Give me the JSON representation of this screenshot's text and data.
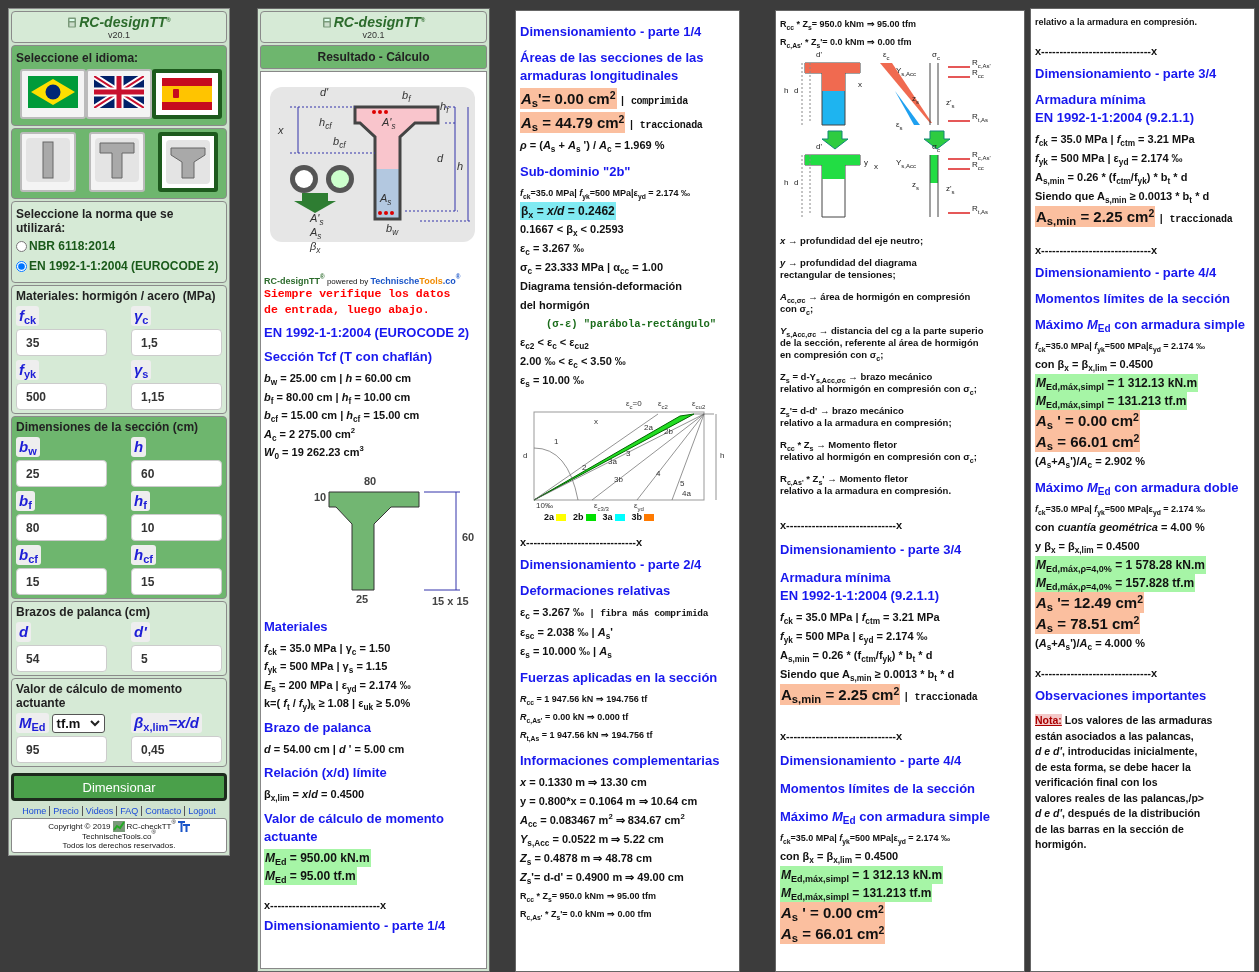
{
  "input_panel": {
    "header": {
      "title": "RC-designTT$^{®}$",
      "version": "v20.1"
    },
    "language": {
      "label": "Seleccione el idioma:",
      "flags": [
        {
          "kind": "brazil",
          "selected": false
        },
        {
          "kind": "uk",
          "selected": false
        },
        {
          "kind": "spain",
          "selected": true
        }
      ]
    },
    "section_types": [
      {
        "kind": "rect",
        "selected": false
      },
      {
        "kind": "tee",
        "selected": false
      },
      {
        "kind": "tee-chamfer",
        "selected": true
      }
    ],
    "norm": {
      "label": "Seleccione la norma que se utilizará:",
      "options": [
        {
          "label": "NBR 6118:2014",
          "selected": false
        },
        {
          "label": "EN 1992-1-1:2004 (EUROCODE 2)",
          "selected": true
        }
      ]
    },
    "groups": [
      {
        "title": "Materiales: hormigón / acero (MPa)",
        "highlighted": false,
        "fields": [
          {
            "label": "f$_{ck}$",
            "value": "35"
          },
          {
            "label": "γ$_{c}$",
            "value": "1,5"
          },
          {
            "label": "f$_{yk}$",
            "value": "500"
          },
          {
            "label": "γ$_{s}$",
            "value": "1,15"
          }
        ]
      },
      {
        "title": "Dimensiones de la sección (cm)",
        "highlighted": true,
        "fields": [
          {
            "label": "b$_{w}$",
            "value": "25"
          },
          {
            "label": "h",
            "value": "60"
          },
          {
            "label": "b$_{f}$",
            "value": "80"
          },
          {
            "label": "h$_{f}$",
            "value": "10"
          },
          {
            "label": "b$_{cf}$",
            "value": "15"
          },
          {
            "label": "h$_{cf}$",
            "value": "15"
          }
        ]
      },
      {
        "title": "Brazos de palanca (cm)",
        "highlighted": false,
        "fields": [
          {
            "label": "d",
            "value": "54"
          },
          {
            "label": "d'",
            "value": "5"
          }
        ]
      },
      {
        "title": "Valor de cálculo de momento actuante",
        "highlighted": false,
        "fields": [
          {
            "label": "M$_{Ed}$",
            "unit": "tf.m",
            "value": "95"
          },
          {
            "label": "β$_{x,lim}$=x/d",
            "value": "0,45"
          }
        ]
      }
    ],
    "submit": "Dimensionar",
    "footer_links": [
      "Home",
      "Precio",
      "Videos",
      "FAQ",
      "Contacto",
      "Logout"
    ],
    "copyright": {
      "text": "Copyright © 2019",
      "product": "RC-checkTT$^{®}$",
      "site": "TechnischeTools.co$^{®}$",
      "rights": "Todos los derechos reservados."
    }
  },
  "results": {
    "header": {
      "title": "RC-designTT$^{®}$",
      "version": "v20.1",
      "caption": "Resultado - Cálculo"
    },
    "columns": [
      {
        "blocks": [
          {
            "kind": "section-illustration",
            "labels": [
              "d'",
              "b$_{f}$",
              "A'$_{s}$",
              "h$_{f}$",
              "x",
              "h$_{cf}$",
              "b$_{cf}$",
              "d",
              "h",
              "A'$_{s}$",
              "A$_{s}$",
              "β$_{x}$",
              "A$_{s}$",
              "b$_{w}$"
            ]
          },
          {
            "kind": "brand",
            "parts": [
              "RC-designTT$^{®}$",
              "powered by",
              "Technische",
              "Tools",
              ".co$^{®}$"
            ]
          },
          {
            "kind": "warning",
            "text": "Siempre verifique los datos\nde entrada, luego abajo."
          },
          {
            "kind": "heading",
            "text": "EN 1992-1-1:2004 (EUROCODE 2)"
          },
          {
            "kind": "heading",
            "text": "Sección Tcf (T con chaflán)"
          },
          {
            "kind": "line",
            "text": "*b*$_{w}$ = 25.00 cm | *h* = 60.00 cm"
          },
          {
            "kind": "line",
            "text": "*b*$_{f}$ = 80.00 cm | *h*$_{f}$ = 10.00 cm"
          },
          {
            "kind": "line",
            "text": "*b*$_{cf}$ = 15.00 cm | *h*$_{cf}$ = 15.00 cm"
          },
          {
            "kind": "line",
            "text": "*A*$_{c}$ = 2 275.00 cm$^{2}$"
          },
          {
            "kind": "line",
            "text": "*W*$_{0}$ = 19 262.23 cm$^{3}$"
          },
          {
            "kind": "tee-drawing",
            "labels": [
              "80",
              "10",
              "60",
              "25",
              "15 x 15"
            ]
          },
          {
            "kind": "heading",
            "text": "Materiales"
          },
          {
            "kind": "line",
            "text": "*f*$_{ck}$ = 35.0 MPa | γ$_{c}$ = 1.50"
          },
          {
            "kind": "line",
            "text": "*f*$_{yk}$ = 500 MPa | γ$_{s}$ = 1.15"
          },
          {
            "kind": "line",
            "text": "*E*$_{s}$ = 200 MPa | ε$_{yd}$ = 2.174 ‰"
          },
          {
            "kind": "line",
            "text": "k=( *f*$_{t}$ / *f*$_{y}$)$_{k}$ ≥ 1.08 | ε$_{uk}$ ≥ 5.0%"
          },
          {
            "kind": "heading",
            "text": "Brazo de palanca"
          },
          {
            "kind": "line",
            "text": "*d* = 54.00 cm | *d* ' = 5.00 cm"
          },
          {
            "kind": "heading",
            "text": "Relación (x/d) límite"
          },
          {
            "kind": "line",
            "text": "β$_{x,lim}$ = *x*/*d* = 0.4500"
          },
          {
            "kind": "heading",
            "text": "Valor de cálculo de momento actuante"
          },
          {
            "kind": "result",
            "text": "*M*$_{Ed}$ = 950.00 kN.m",
            "color": "#a6f5a6"
          },
          {
            "kind": "result",
            "text": "*M*$_{Ed}$ = 95.00 tf.m",
            "color": "#a6f5a6"
          },
          {
            "kind": "separator",
            "text": "x------------------------------x"
          },
          {
            "kind": "heading",
            "text": "Dimensionamiento - parte 1/4"
          }
        ]
      },
      {
        "blocks": [
          {
            "kind": "heading",
            "text": "Dimensionamiento - parte 1/4"
          },
          {
            "kind": "heading",
            "text": "Áreas de las secciones de las armaduras longitudinales"
          },
          {
            "kind": "big-result",
            "text": "*A*$_{s}$'= 0.00 cm$^{2}$",
            "note": "| comprimida",
            "color": "#fbbf9f"
          },
          {
            "kind": "big-result",
            "text": "*A*$_{s}$ = 44.79 cm$^{2}$",
            "note": "| traccionada",
            "color": "#fbbf9f"
          },
          {
            "kind": "line",
            "text": "*ρ* = (*A*$_{s}$ + *A*$_{s}$ ') / *A*$_{c}$ = 1.969 %"
          },
          {
            "kind": "heading",
            "text": "Sub-dominio \"2b\""
          },
          {
            "kind": "small",
            "text": "*f*$_{ck}$=35.0 MPa| *f*$_{yk}$=500 MPa|ε$_{yd}$ = 2.174 ‰"
          },
          {
            "kind": "result",
            "text": "β$_{x}$ = *x/d* = 0.2462",
            "color": "#80eaf2"
          },
          {
            "kind": "line",
            "text": "0.1667 < β$_{x}$ < 0.2593"
          },
          {
            "kind": "line",
            "text": "ε$_{c}$ = 3.267 ‰"
          },
          {
            "kind": "line",
            "text": "σ$_{c}$ = 23.333 MPa | α$_{cc}$ = 1.00"
          },
          {
            "kind": "line",
            "text": "Diagrama tensión-deformación\ndel hormigón"
          },
          {
            "kind": "formula",
            "text": "(σ-ε) \"parábola-rectángulo\""
          },
          {
            "kind": "line",
            "text": "ε$_{c2}$ < ε$_{c}$ < ε$_{cu2}$"
          },
          {
            "kind": "line",
            "text": "2.00 ‰ < ε$_{c}$ < 3.50 ‰"
          },
          {
            "kind": "line",
            "text": "ε$_{s}$ = 10.00 ‰"
          },
          {
            "kind": "strain-drawing",
            "labels": [
              "ε$_{c}$=0",
              "ε$_{c2}$",
              "ε$_{cu2}$",
              "x",
              "d",
              "h",
              "1",
              "2",
              "3",
              "4",
              "5",
              "2a",
              "2b",
              "3a",
              "3b",
              "4a",
              "10‰",
              "ε$_{c3/3}$",
              "ε$_{yd}$"
            ],
            "legend": [
              {
                "label": "2a",
                "color": "#ffff00"
              },
              {
                "label": "2b",
                "color": "#00e000"
              },
              {
                "label": "3a",
                "color": "#00ffff"
              },
              {
                "label": "3b",
                "color": "#ff7a00"
              }
            ]
          },
          {
            "kind": "separator",
            "text": "x------------------------------x"
          },
          {
            "kind": "heading",
            "text": "Dimensionamiento - parte 2/4"
          },
          {
            "kind": "heading",
            "text": "Deformaciones relativas"
          },
          {
            "kind": "line",
            "text": "ε$_{c}$ = 3.267 ‰",
            "note": "| fibra más comprimida"
          },
          {
            "kind": "line",
            "text": "ε$_{sc}$ = 2.038 ‰ | *A*$_{s}$'"
          },
          {
            "kind": "line",
            "text": "ε$_{s}$ = 10.000 ‰ | *A*$_{s}$"
          },
          {
            "kind": "heading",
            "text": "Fuerzas aplicadas en la sección"
          },
          {
            "kind": "small",
            "text": "*R*$_{cc}$ = 1 947.56 kN ⇒ 194.756 tf"
          },
          {
            "kind": "small",
            "text": "*R*$_{c,As'}$ = 0.00 kN ⇒ 0.000 tf"
          },
          {
            "kind": "small",
            "text": "*R*$_{t,As}$ = 1 947.56 kN ⇒ 194.756 tf"
          },
          {
            "kind": "heading",
            "text": "Informaciones complementarias"
          },
          {
            "kind": "line",
            "text": "*x* = 0.1330 m ⇒ 13.30 cm"
          },
          {
            "kind": "line",
            "text": "y = 0.800*x = 0.1064 m ⇒ 10.64 cm"
          },
          {
            "kind": "line",
            "text": "*A*$_{cc}$ = 0.083467 m$^{2}$ ⇒ 834.67 cm$^{2}$"
          },
          {
            "kind": "line",
            "text": "*Y*$_{s,Acc}$ = 0.0522 m ⇒ 5.22 cm"
          },
          {
            "kind": "line",
            "text": "*Z*$_{s}$ = 0.4878 m ⇒ 48.78 cm"
          },
          {
            "kind": "line",
            "text": "*Z*$_{s}$'=  d-d' = 0.4900 m ⇒ 49.00 cm"
          },
          {
            "kind": "small",
            "text": "R$_{cc}$ * Z$_{s}$= 950.0 kNm ⇒ 95.00 tfm"
          },
          {
            "kind": "small",
            "text": "R$_{c,As'}$ * Z$_{s}$'= 0.0 kNm ⇒ 0.00 tfm"
          }
        ]
      },
      {
        "blocks": [
          {
            "kind": "small",
            "text": "R$_{cc}$ * Z$_{s}$= 950.0 kNm ⇒ 95.00 tfm"
          },
          {
            "kind": "small",
            "text": "R$_{c,As'}$ * Z$_{s}$'= 0.0 kNm ⇒ 0.00 tfm"
          },
          {
            "kind": "force-drawing",
            "labels": [
              "d'",
              "ε$_{c}$",
              "σ$_{c}$",
              "R$_{c,As'}$",
              "R$_{cc}$",
              "h",
              "d",
              "x",
              "Y$_{s,Acc}$",
              "z$_{s}$",
              "z'$_{s}$",
              "R$_{t,As}$",
              "ε$_{s}$",
              "d'",
              "σ$_{c}$",
              "R$_{c,As'}$",
              "R$_{cc}$",
              "h",
              "d",
              "y",
              "x",
              "Y$_{s,Acc}$",
              "z$_{s}$",
              "z'$_{s}$",
              "R$_{t,As}$"
            ]
          },
          {
            "kind": "definition",
            "text": "*x* → profundidad del eje neutro;"
          },
          {
            "kind": "definition",
            "text": "*y* → profundidad del diagrama\nrectangular de tensiones;"
          },
          {
            "kind": "definition",
            "text": "*A*$_{cc,σc}$ → área de hormigón en compresión\ncon σ$_{c}$;"
          },
          {
            "kind": "definition",
            "text": "*Y*$_{s,Acc,σc}$ → distancia del cg a la parte superio\nde la sección, referente al área de hormigón\nen compresión con σ$_{c}$;"
          },
          {
            "kind": "definition",
            "text": "Z$_{s}$ = d-Y$_{s,Acc,σc}$ → brazo mecánico\nrelativo al hormigón en compresión con σ$_{c}$;"
          },
          {
            "kind": "definition",
            "text": "Z$_{s}$'= d-d' → brazo mecánico\nrelativo a la armadura en compresión;"
          },
          {
            "kind": "definition",
            "text": "R$_{cc}$ * Z$_{s}$ → Momento fletor\nrelativo al hormigón en compresión con σ$_{c}$;"
          },
          {
            "kind": "definition",
            "text": "R$_{c,As'}$ * Z$_{s}$' → Momento fletor\nrelativo a la armadura en compresión."
          },
          {
            "kind": "separator",
            "text": "x------------------------------x"
          },
          {
            "kind": "heading",
            "text": "Dimensionamiento - parte 3/4"
          },
          {
            "kind": "heading",
            "text": "Armadura mínima\nEN 1992-1-1:2004 (9.2.1.1)"
          },
          {
            "kind": "line",
            "text": "*f*$_{ck}$ = 35.0 MPa | *f*$_{ctm}$ = 3.21 MPa"
          },
          {
            "kind": "line",
            "text": "*f*$_{yk}$ = 500 MPa | ε$_{yd}$ = 2.174 ‰"
          },
          {
            "kind": "line",
            "text": "A$_{s,min}$ = 0.26 * (f$_{ctm}$/f$_{yk}$) * b$_{t}$ * d"
          },
          {
            "kind": "line",
            "text": "Siendo que A$_{s,min}$ ≥ 0.0013 * b$_{t}$ * d"
          },
          {
            "kind": "big-result",
            "text": "A$_{s,min}$ = 2.25 cm$^{2}$",
            "note": "| traccionada",
            "color": "#fbbf9f"
          },
          {
            "kind": "separator",
            "text": "x------------------------------x"
          },
          {
            "kind": "heading",
            "text": "Dimensionamiento - parte 4/4"
          },
          {
            "kind": "heading",
            "text": "Momentos límites de la sección"
          },
          {
            "kind": "heading",
            "text": "Máximo *M*$_{Ed}$ con armadura simple"
          },
          {
            "kind": "small",
            "text": "*f*$_{ck}$=35.0 MPa| *f*$_{yk}$=500 MPa|ε$_{yd}$ = 2.174 ‰"
          },
          {
            "kind": "line",
            "text": "con β$_{x}$ = β$_{x,lim}$ = 0.4500"
          },
          {
            "kind": "result",
            "text": "*M*$_{Ed,máx,simpl}$ = 1 312.13 kN.m",
            "color": "#a6f5a6"
          },
          {
            "kind": "result",
            "text": "*M*$_{Ed,máx,simpl}$ = 131.213 tf.m",
            "color": "#a6f5a6"
          },
          {
            "kind": "big-result",
            "text": "*A*$_{s}$ ' = 0.00 cm$^{2}$",
            "color": "#fbbf9f"
          },
          {
            "kind": "big-result",
            "text": "*A*$_{s}$ = 66.01 cm$^{2}$",
            "color": "#fbbf9f"
          }
        ]
      },
      {
        "blocks": [
          {
            "kind": "small",
            "text": "relativo a la armadura en compresión."
          },
          {
            "kind": "separator",
            "text": "x------------------------------x"
          },
          {
            "kind": "heading",
            "text": "Dimensionamiento - parte 3/4"
          },
          {
            "kind": "heading",
            "text": "Armadura mínima\nEN 1992-1-1:2004 (9.2.1.1)"
          },
          {
            "kind": "line",
            "text": "*f*$_{ck}$ = 35.0 MPa | *f*$_{ctm}$ = 3.21 MPa"
          },
          {
            "kind": "line",
            "text": "*f*$_{yk}$ = 500 MPa | ε$_{yd}$ = 2.174 ‰"
          },
          {
            "kind": "line",
            "text": "A$_{s,min}$ = 0.26 * (f$_{ctm}$/f$_{yk}$) * b$_{t}$ * d"
          },
          {
            "kind": "line",
            "text": "Siendo que A$_{s,min}$ ≥ 0.0013 * b$_{t}$ * d"
          },
          {
            "kind": "big-result",
            "text": "A$_{s,min}$ = 2.25 cm$^{2}$",
            "note": "| traccionada",
            "color": "#fbbf9f"
          },
          {
            "kind": "separator",
            "text": "x------------------------------x"
          },
          {
            "kind": "heading",
            "text": "Dimensionamiento - parte 4/4"
          },
          {
            "kind": "heading",
            "text": "Momentos límites de la sección"
          },
          {
            "kind": "heading",
            "text": "Máximo *M*$_{Ed}$ con armadura simple"
          },
          {
            "kind": "small",
            "text": "*f*$_{ck}$=35.0 MPa| *f*$_{yk}$=500 MPa|ε$_{yd}$ = 2.174 ‰"
          },
          {
            "kind": "line",
            "text": "con β$_{x}$ = β$_{x,lim}$ = 0.4500"
          },
          {
            "kind": "result",
            "text": "*M*$_{Ed,máx,simpl}$ = 1 312.13 kN.m",
            "color": "#a6f5a6"
          },
          {
            "kind": "result",
            "text": "*M*$_{Ed,máx,simpl}$ = 131.213 tf.m",
            "color": "#a6f5a6"
          },
          {
            "kind": "big-result",
            "text": "*A*$_{s}$ ' = 0.00 cm$^{2}$",
            "color": "#fbbf9f"
          },
          {
            "kind": "big-result",
            "text": "*A*$_{s}$ = 66.01 cm$^{2}$",
            "color": "#fbbf9f"
          },
          {
            "kind": "line",
            "text": "(*A*$_{s}$+*A*$_{s}$')/*A*$_{c}$ = 2.902 %"
          },
          {
            "kind": "heading",
            "text": "Máximo *M*$_{Ed}$ con armadura doble"
          },
          {
            "kind": "small",
            "text": "*f*$_{ck}$=35.0 MPa| *f*$_{yk}$=500 MPa|ε$_{yd}$ = 2.174 ‰"
          },
          {
            "kind": "line",
            "text": "con *cuantía geométrica* = 4.00 %"
          },
          {
            "kind": "line",
            "text": "y β$_{x}$ = β$_{x,lim}$ = 0.4500"
          },
          {
            "kind": "result",
            "text": "*M*$_{Ed,máx,ρ=4,0%}$ = 1 578.28 kN.m",
            "color": "#a6f5a6"
          },
          {
            "kind": "result",
            "text": "*M*$_{Ed,máx,ρ=4,0%}$ = 157.828 tf.m",
            "color": "#a6f5a6"
          },
          {
            "kind": "big-result",
            "text": "*A*$_{s}$ '= 12.49 cm$^{2}$",
            "color": "#fbbf9f"
          },
          {
            "kind": "big-result",
            "text": "*A*$_{s}$ = 78.51 cm$^{2}$",
            "color": "#fbbf9f"
          },
          {
            "kind": "line",
            "text": "(*A*$_{s}$+*A*$_{s}$')/*A*$_{c}$ = 4.000 %"
          },
          {
            "kind": "separator",
            "text": "x------------------------------x"
          },
          {
            "kind": "heading",
            "text": "Observaciones importantes"
          },
          {
            "kind": "note",
            "label": "Nota:",
            "text": "Los valores de las armaduras\nestán asociados a las palancas,\n*d e d'*, introducidas inicialmente,\nde esta forma, se debe hacer la\nverificación final con los\nvalores reales de las palancas,/p>\n*d e d'*, después de la distribución\nde las barras en la sección de\nhormigón."
          }
        ]
      }
    ]
  }
}
